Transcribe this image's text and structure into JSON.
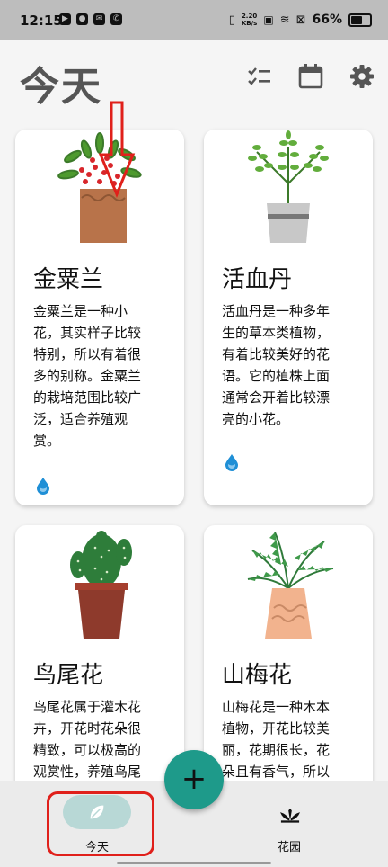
{
  "status_bar": {
    "time": "12:15",
    "speed_top": "2.20",
    "speed_bottom": "KB/s",
    "battery": "66%"
  },
  "header": {
    "title": "今天"
  },
  "cards": [
    {
      "name": "金粟兰",
      "desc": [
        "金粟兰是一种小",
        "花，其实样子比较",
        "特别，所以有着很",
        "多的别称。金粟兰",
        "的栽培范围比较广",
        "泛，适合养殖观",
        "赏。"
      ]
    },
    {
      "name": "活血丹",
      "desc": [
        "活血丹是一种多年",
        "生的草本类植物，",
        "有着比较美好的花",
        "语。它的植株上面",
        "通常会开着比较漂",
        "亮的小花。"
      ]
    },
    {
      "name": "鸟尾花",
      "desc": [
        "鸟尾花属于灌木花",
        "卉，开花时花朵很",
        "精致，可以极高的",
        "观赏性，养殖鸟尾"
      ]
    },
    {
      "name": "山梅花",
      "desc": [
        "山梅花是一种木本",
        "植物，开花比较美",
        "丽，花期很长，花",
        "朵且有香气，所以"
      ]
    }
  ],
  "fab": {
    "label": "+"
  },
  "bottom_nav": {
    "today_label": "今天",
    "garden_label": "花园"
  },
  "colors": {
    "accent": "#1e9a8a",
    "nav_pill": "#b8d8d6",
    "annotation": "#e0201b",
    "water_drop": "#1f8fd6"
  }
}
